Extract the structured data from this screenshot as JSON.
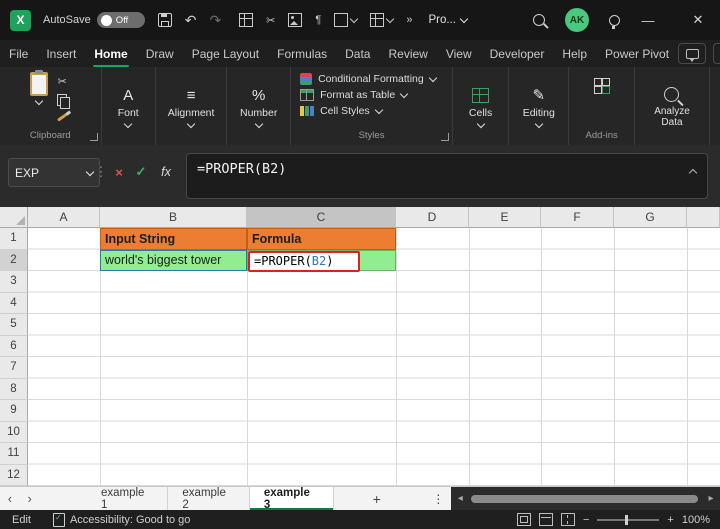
{
  "titlebar": {
    "autosave_label": "AutoSave",
    "autosave_state": "Off",
    "doc_menu_label": "Pro...",
    "avatar_initials": "AK"
  },
  "menubar": {
    "tabs": [
      "File",
      "Insert",
      "Home",
      "Draw",
      "Page Layout",
      "Formulas",
      "Data",
      "Review",
      "View",
      "Developer",
      "Help",
      "Power Pivot"
    ],
    "active_tab": "Home"
  },
  "ribbon": {
    "group_labels": {
      "clipboard": "Clipboard",
      "styles": "Styles",
      "addins": "Add-ins"
    },
    "font_label": "Font",
    "alignment_label": "Alignment",
    "number_label": "Number",
    "styles_buttons": [
      "Conditional Formatting",
      "Format as Table",
      "Cell Styles"
    ],
    "cells_label": "Cells",
    "editing_label": "Editing",
    "analyze_label": "Analyze Data"
  },
  "formula_bar": {
    "name_box": "EXP",
    "fx_label": "fx",
    "formula": "=PROPER(B2)"
  },
  "sheet": {
    "columns": [
      "A",
      "B",
      "C",
      "D",
      "E",
      "F",
      "G"
    ],
    "rows": [
      "1",
      "2",
      "3",
      "4",
      "5",
      "6",
      "7",
      "8",
      "9",
      "10",
      "11",
      "12"
    ],
    "cells": {
      "b1": "Input String",
      "c1": "Formula",
      "b2": "world's biggest tower",
      "c2_prefix": "=PROPER(",
      "c2_ref": "B2",
      "c2_suffix": ")"
    }
  },
  "sheet_tabs": {
    "tabs": [
      "example 1",
      "example 2",
      "example 3"
    ],
    "active": "example 3"
  },
  "status_bar": {
    "mode": "Edit",
    "accessibility": "Accessibility: Good to go",
    "zoom": "100%"
  },
  "icons": {
    "logo": "X",
    "undo": "↶",
    "redo": "↷",
    "cut": "✂",
    "paragraph": "¶",
    "overflow": "»",
    "more_dots": "⋮",
    "cancel": "×",
    "enter": "✓",
    "minimize": "—",
    "close": "✕",
    "font": "A",
    "alignment": "≡",
    "number": "%",
    "editing": "✎",
    "tab_prev": "‹",
    "tab_next": "›",
    "add_sheet": "+",
    "scroll_left": "◂",
    "scroll_right": "▸",
    "zoom_out": "−",
    "zoom_in": "+"
  },
  "colors": {
    "accent_green": "#107C41",
    "header_fill_orange": "#ED7D31",
    "cell_fill_green": "#90EE90",
    "reference_blue": "#2E75B6",
    "annotation_red": "#E02020"
  }
}
